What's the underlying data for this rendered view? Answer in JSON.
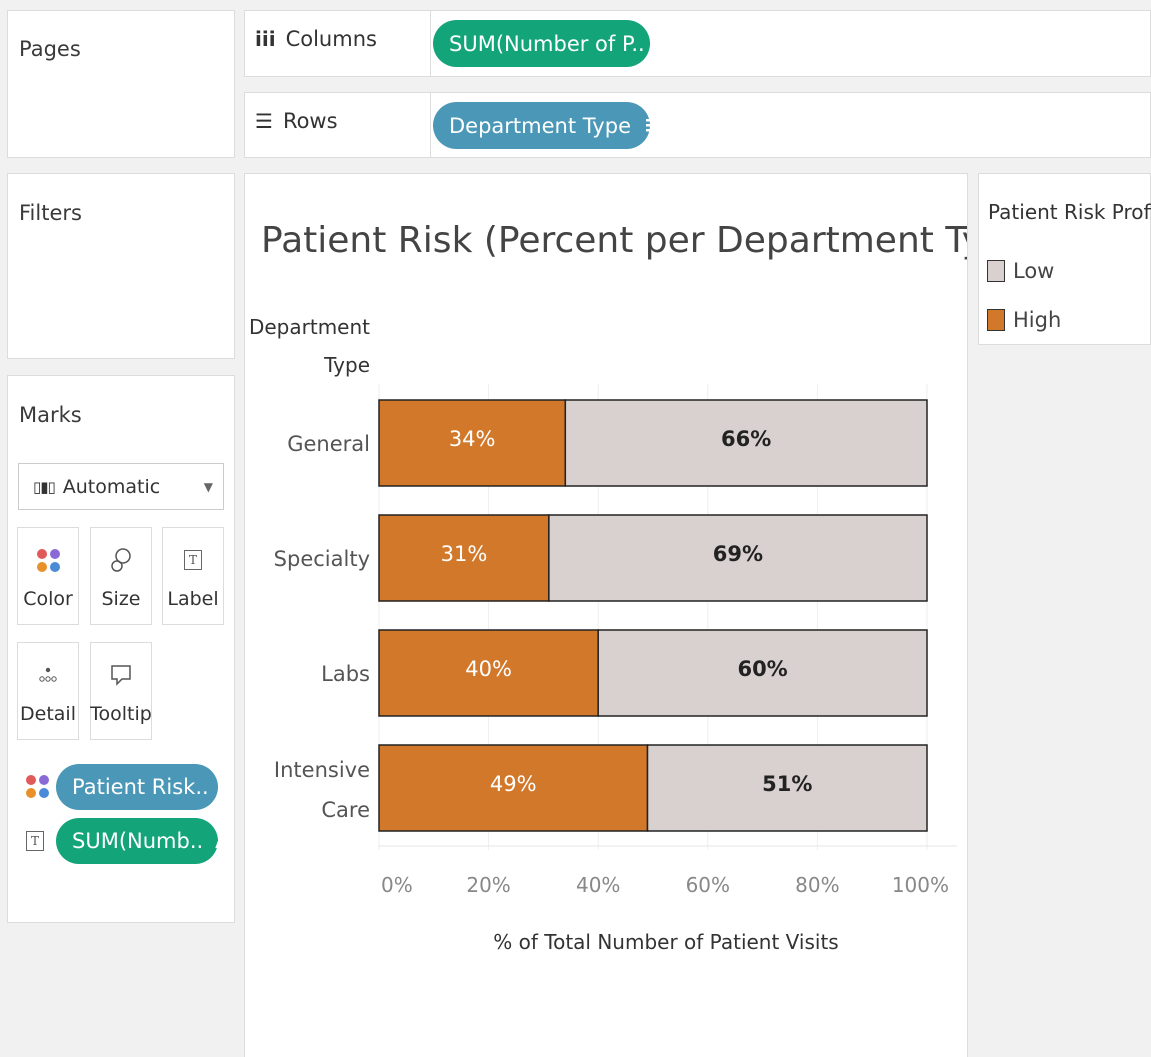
{
  "pages": {
    "title": "Pages"
  },
  "columns": {
    "label": "Columns",
    "pill": "SUM(Number of P..",
    "pill_icon": "Δ"
  },
  "rows": {
    "label": "Rows",
    "pill": "Department Type",
    "pill_icon": "sort-icon"
  },
  "filters": {
    "title": "Filters"
  },
  "marks": {
    "title": "Marks",
    "mark_type": "Automatic",
    "buttons": {
      "color": "Color",
      "size": "Size",
      "label": "Label",
      "detail": "Detail",
      "tooltip": "Tooltip"
    },
    "pills": [
      {
        "kind": "color",
        "label": "Patient Risk..",
        "icon": "sort-icon"
      },
      {
        "kind": "label",
        "label": "SUM(Numb..",
        "icon": "Δ"
      }
    ]
  },
  "legend": {
    "title": "Patient Risk Profile",
    "items": [
      {
        "label": "Low",
        "color": "#d9d1cf"
      },
      {
        "label": "High",
        "color": "#d2782a"
      }
    ]
  },
  "chart_data": {
    "type": "bar",
    "orientation": "horizontal",
    "stacked": true,
    "title": "Patient Risk (Percent per Department Type)",
    "ylabel": "Department Type",
    "xlabel": "% of Total Number of Patient Visits",
    "categories": [
      "General",
      "Specialty",
      "Labs",
      "Intensive Care"
    ],
    "xlim": [
      0,
      100
    ],
    "x_ticks": [
      "0%",
      "20%",
      "40%",
      "60%",
      "80%",
      "100%"
    ],
    "series": [
      {
        "name": "High",
        "color": "#d2782a",
        "values": [
          34,
          31,
          40,
          49
        ],
        "labels": [
          "34%",
          "31%",
          "40%",
          "49%"
        ]
      },
      {
        "name": "Low",
        "color": "#d9d1cf",
        "values": [
          66,
          69,
          60,
          51
        ],
        "labels": [
          "66%",
          "69%",
          "60%",
          "51%"
        ]
      }
    ],
    "grid": false,
    "legend": "right"
  }
}
